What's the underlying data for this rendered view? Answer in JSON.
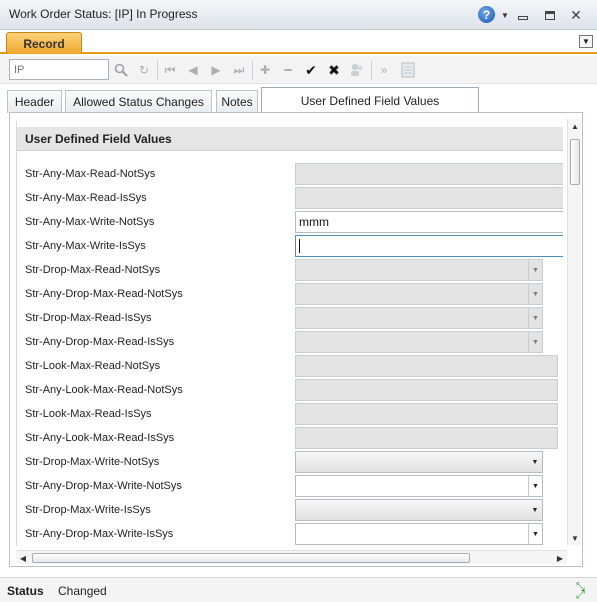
{
  "window": {
    "title": "Work Order Status: [IP] In Progress",
    "help": "?",
    "close": "✕"
  },
  "record_tab": {
    "label": "Record"
  },
  "toolbar": {
    "search_value": "IP"
  },
  "tabs": [
    {
      "label": "Header"
    },
    {
      "label": "Allowed Status Changes"
    },
    {
      "label": "Notes"
    },
    {
      "label": "User Defined Field Values"
    }
  ],
  "section": {
    "title": "User Defined Field Values",
    "rows": [
      {
        "label": "Str-Any-Max-Read-NotSys",
        "value": ""
      },
      {
        "label": "Str-Any-Max-Read-IsSys",
        "value": ""
      },
      {
        "label": "Str-Any-Max-Write-NotSys",
        "value": "mmm"
      },
      {
        "label": "Str-Any-Max-Write-IsSys",
        "value": ""
      },
      {
        "label": "Str-Drop-Max-Read-NotSys",
        "value": ""
      },
      {
        "label": "Str-Any-Drop-Max-Read-NotSys",
        "value": ""
      },
      {
        "label": "Str-Drop-Max-Read-IsSys",
        "value": ""
      },
      {
        "label": "Str-Any-Drop-Max-Read-IsSys",
        "value": ""
      },
      {
        "label": "Str-Look-Max-Read-NotSys",
        "value": ""
      },
      {
        "label": "Str-Any-Look-Max-Read-NotSys",
        "value": ""
      },
      {
        "label": "Str-Look-Max-Read-IsSys",
        "value": ""
      },
      {
        "label": "Str-Any-Look-Max-Read-IsSys",
        "value": ""
      },
      {
        "label": "Str-Drop-Max-Write-NotSys",
        "value": ""
      },
      {
        "label": "Str-Any-Drop-Max-Write-NotSys",
        "value": ""
      },
      {
        "label": "Str-Drop-Max-Write-IsSys",
        "value": ""
      },
      {
        "label": "Str-Any-Drop-Max-Write-IsSys",
        "value": ""
      }
    ]
  },
  "status": {
    "label": "Status",
    "value": "Changed"
  }
}
